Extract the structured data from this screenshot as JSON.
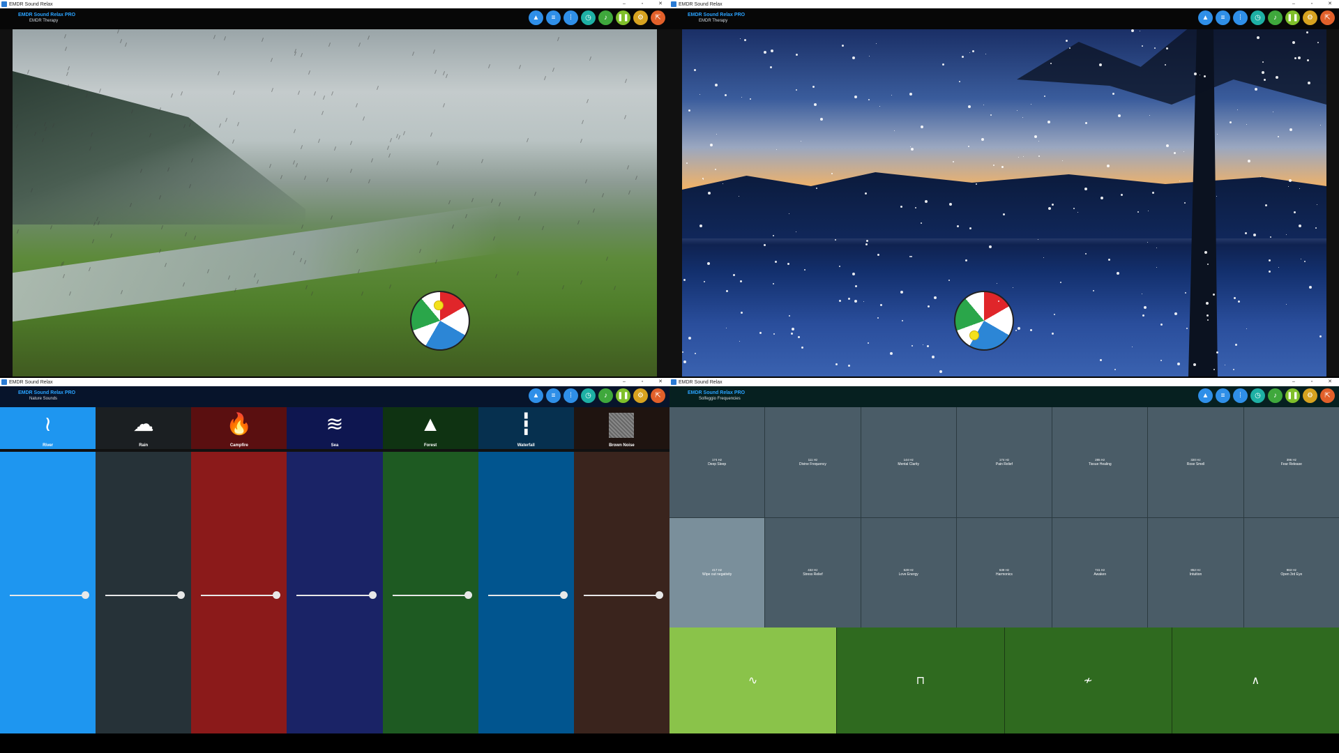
{
  "windows": {
    "top_left": {
      "title": "EMDR Sound Relax",
      "app_name": "EMDR Sound Relax PRO",
      "subtitle": "EMDR Therapy"
    },
    "top_right": {
      "title": "EMDR Sound Relax",
      "app_name": "EMDR Sound Relax PRO",
      "subtitle": "EMDR Therapy"
    },
    "bottom_left": {
      "title": "EMDR Sound Relax",
      "app_name": "EMDR Sound Relax PRO",
      "subtitle": "Nature Sounds",
      "sounds": [
        {
          "label": "River",
          "icon": "river-icon",
          "glyph": "≀",
          "color": "#1e96f0",
          "volume": 1.0
        },
        {
          "label": "Rain",
          "icon": "rain-cloud-icon",
          "glyph": "☁",
          "color": "#263238",
          "volume": 1.0
        },
        {
          "label": "Campfire",
          "icon": "flame-icon",
          "glyph": "🔥",
          "color": "#8b1a1a",
          "volume": 1.0
        },
        {
          "label": "Sea",
          "icon": "waves-icon",
          "glyph": "≋",
          "color": "#1a2366",
          "volume": 1.0
        },
        {
          "label": "Forest",
          "icon": "pine-tree-icon",
          "glyph": "▲",
          "color": "#1e5a22",
          "volume": 1.0
        },
        {
          "label": "Waterfall",
          "icon": "waterfall-icon",
          "glyph": "┇",
          "color": "#01558f",
          "volume": 1.0
        },
        {
          "label": "Brown Noise",
          "icon": "noise-texture-icon",
          "glyph": "",
          "color": "#3a241d",
          "volume": 1.0
        }
      ],
      "header_colors": [
        "#1e96f0",
        "#1b1f22",
        "#5a0f10",
        "#0e1650",
        "#0f3312",
        "#06304f",
        "#1f1410"
      ]
    },
    "bottom_right": {
      "title": "EMDR Sound Relax",
      "app_name": "EMDR Sound Relax PRO",
      "subtitle": "Solfeggio Frequencies",
      "frequencies": [
        {
          "hz": "174 Hz",
          "name": "Deep Sleep",
          "active": false
        },
        {
          "hz": "111 Hz",
          "name": "Divine Frequency",
          "active": false
        },
        {
          "hz": "144 Hz",
          "name": "Mental Clarity",
          "active": false
        },
        {
          "hz": "174 Hz",
          "name": "Pain Relief",
          "active": false
        },
        {
          "hz": "285 Hz",
          "name": "Tissue Healing",
          "active": false
        },
        {
          "hz": "320 Hz",
          "name": "Rose Smell",
          "active": false
        },
        {
          "hz": "396 Hz",
          "name": "Fear Release",
          "active": false
        },
        {
          "hz": "417 Hz",
          "name": "Wipe out negativity",
          "active": true
        },
        {
          "hz": "432 Hz",
          "name": "Stress Relief",
          "active": false
        },
        {
          "hz": "528 Hz",
          "name": "Love Energy",
          "active": false
        },
        {
          "hz": "639 Hz",
          "name": "Harmonics",
          "active": false
        },
        {
          "hz": "741 Hz",
          "name": "Awaken",
          "active": false
        },
        {
          "hz": "852 Hz",
          "name": "Intuition",
          "active": false
        },
        {
          "hz": "963 Hz",
          "name": "Open 3rd Eye",
          "active": false
        }
      ],
      "waveforms": [
        {
          "icon": "sine-wave-icon",
          "glyph": "∿",
          "active": true
        },
        {
          "icon": "square-wave-icon",
          "glyph": "⊓",
          "active": false
        },
        {
          "icon": "sawtooth-wave-icon",
          "glyph": "≁",
          "active": false
        },
        {
          "icon": "triangle-wave-icon",
          "glyph": "∧",
          "active": false
        }
      ]
    }
  },
  "window_controls": {
    "minimize": "–",
    "maximize": "▫",
    "close": "✕"
  },
  "toolbar": [
    {
      "icon": "landscape-icon",
      "glyph": "▲",
      "color": "blue"
    },
    {
      "icon": "waves-menu-icon",
      "glyph": "≡",
      "color": "blue"
    },
    {
      "icon": "sound-wave-icon",
      "glyph": "⁞",
      "color": "blue"
    },
    {
      "icon": "timer-icon",
      "glyph": "◷",
      "color": "teal"
    },
    {
      "icon": "music-note-icon",
      "glyph": "♪",
      "color": "green"
    },
    {
      "icon": "pause-icon",
      "glyph": "❚❚",
      "color": "lime"
    },
    {
      "icon": "settings-gear-icon",
      "glyph": "⚙",
      "color": "amber"
    },
    {
      "icon": "external-open-icon",
      "glyph": "⇱",
      "color": "orange"
    }
  ]
}
